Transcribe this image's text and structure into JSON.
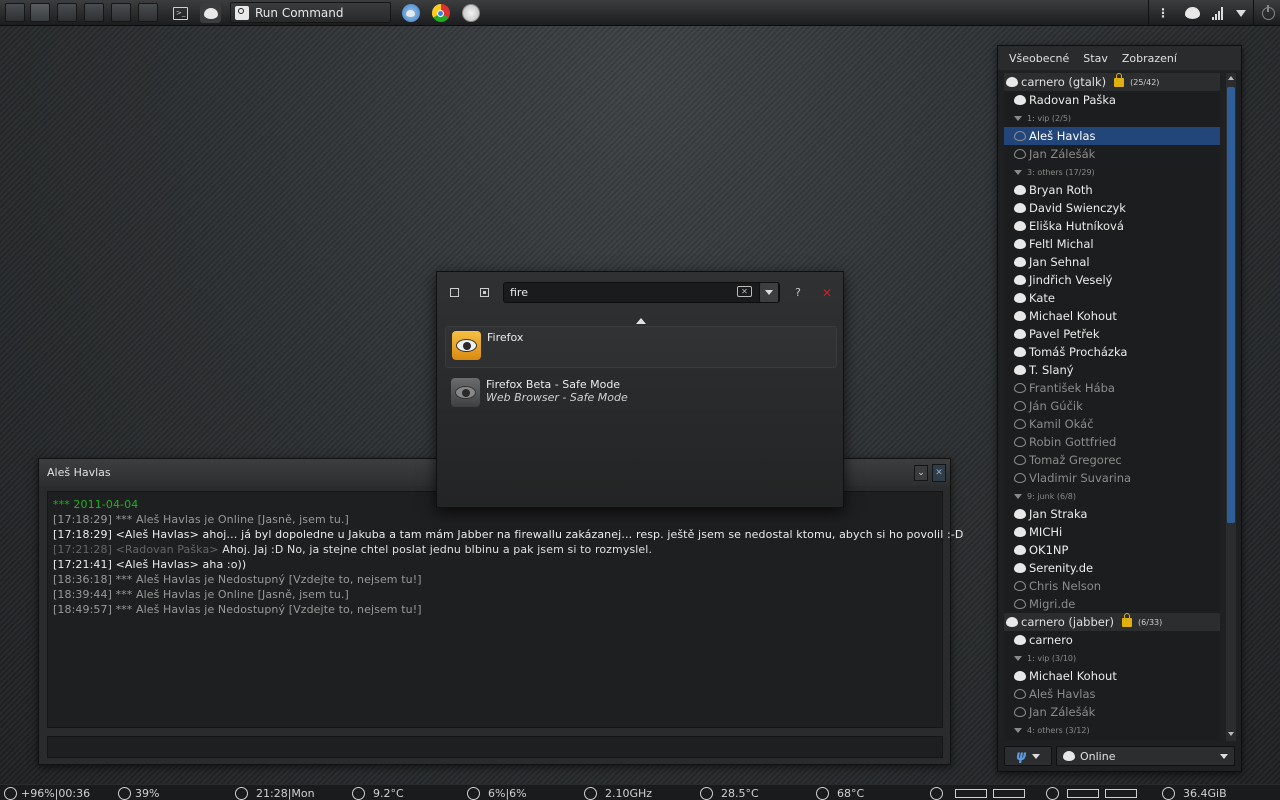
{
  "top_panel": {
    "run_command_label": "Run Command"
  },
  "bottom_panel": {
    "battery": "+96%|00:36",
    "volume": "39%",
    "clock": "21:28|Mon",
    "weather": "9.2°C",
    "cpu": "6%|6%",
    "cpu_freq": "2.10GHz",
    "temp1": "28.5°C",
    "temp2": "68°C",
    "disk": "36.4GiB"
  },
  "chat": {
    "title": "Aleš Havlas",
    "date_line": "*** 2011-04-04",
    "lines": [
      {
        "text": "[17:18:29] *** Aleš Havlas je Online [Jasně, jsem tu.]",
        "kind": "status"
      },
      {
        "text": "[17:18:29] <Aleš Havlas> ahoj… já byl dopoledne u Jakuba a tam mám Jabber na firewallu zakázanej… resp. ještě jsem se nedostal ktomu, abych si ho povolil :-D",
        "kind": "incoming"
      },
      {
        "text": "[17:21:28] <Radovan Paška> Ahoj. Jaj :D No, ja stejne chtel poslat jednu blbinu a pak jsem si to rozmyslel.",
        "kind": "own"
      },
      {
        "text": "[17:21:41] <Aleš Havlas> aha :o))",
        "kind": "incoming"
      },
      {
        "text": "[18:36:18] *** Aleš Havlas je Nedostupný [Vzdejte to, nejsem tu!]",
        "kind": "status"
      },
      {
        "text": "[18:39:44] *** Aleš Havlas je Online [Jasně, jsem tu.]",
        "kind": "status"
      },
      {
        "text": "[18:49:57] *** Aleš Havlas je Nedostupný [Vzdejte to, nejsem tu!]",
        "kind": "status"
      }
    ],
    "own_prefix": "[17:21:28] <Radovan Paška>",
    "own_text": " Ahoj. Jaj :D No, ja stejne chtel poslat jednu blbinu a pak jsem si to rozmyslel."
  },
  "krunner": {
    "query": "fire",
    "help_label": "?",
    "results": [
      {
        "title": "Firefox",
        "subtitle": ""
      },
      {
        "title": "Firefox Beta - Safe Mode",
        "subtitle": "Web Browser - Safe Mode"
      }
    ]
  },
  "buddy_list": {
    "menu": [
      "Všeobecné",
      "Stav",
      "Zobrazení"
    ],
    "status_value": "Online",
    "rows": [
      {
        "type": "account",
        "label": "carnero (gtalk)",
        "count": "(25/42)"
      },
      {
        "type": "contact",
        "label": "Radovan Paška",
        "status": "online"
      },
      {
        "type": "group",
        "label": "1: vip  (2/5)"
      },
      {
        "type": "contact",
        "label": "Aleš Havlas",
        "status": "offline",
        "selected": true
      },
      {
        "type": "contact",
        "label": "Jan Zálešák",
        "status": "offline"
      },
      {
        "type": "group",
        "label": "3: others  (17/29)"
      },
      {
        "type": "contact",
        "label": "Bryan Roth",
        "status": "online"
      },
      {
        "type": "contact",
        "label": "David Swienczyk",
        "status": "online"
      },
      {
        "type": "contact",
        "label": "Eliška Hutníková",
        "status": "online"
      },
      {
        "type": "contact",
        "label": "Feltl Michal",
        "status": "online"
      },
      {
        "type": "contact",
        "label": "Jan Sehnal",
        "status": "online"
      },
      {
        "type": "contact",
        "label": "Jindřich Veselý",
        "status": "online"
      },
      {
        "type": "contact",
        "label": "Kate",
        "status": "online"
      },
      {
        "type": "contact",
        "label": "Michael Kohout",
        "status": "online"
      },
      {
        "type": "contact",
        "label": "Pavel Petřek",
        "status": "online"
      },
      {
        "type": "contact",
        "label": "Tomáš Procházka",
        "status": "online"
      },
      {
        "type": "contact",
        "label": "T. Slaný",
        "status": "online"
      },
      {
        "type": "contact",
        "label": "František Hába",
        "status": "offline"
      },
      {
        "type": "contact",
        "label": "Ján Gúčik",
        "status": "offline"
      },
      {
        "type": "contact",
        "label": "Kamil Okáč",
        "status": "offline"
      },
      {
        "type": "contact",
        "label": "Robin Gottfried",
        "status": "offline"
      },
      {
        "type": "contact",
        "label": "Tomaž Gregorec",
        "status": "offline"
      },
      {
        "type": "contact",
        "label": "Vladimir Suvarina",
        "status": "offline"
      },
      {
        "type": "group",
        "label": "9: junk  (6/8)"
      },
      {
        "type": "contact",
        "label": "Jan Straka",
        "status": "online"
      },
      {
        "type": "contact",
        "label": "MICHi",
        "status": "online"
      },
      {
        "type": "contact",
        "label": "OK1NP",
        "status": "online"
      },
      {
        "type": "contact",
        "label": "Serenity.de",
        "status": "online"
      },
      {
        "type": "contact",
        "label": "Chris Nelson",
        "status": "offline"
      },
      {
        "type": "contact",
        "label": "Migri.de",
        "status": "offline"
      },
      {
        "type": "account",
        "label": "carnero (jabber)",
        "count": "(6/33)"
      },
      {
        "type": "contact",
        "label": "carnero",
        "status": "online"
      },
      {
        "type": "group",
        "label": "1: vip  (3/10)"
      },
      {
        "type": "contact",
        "label": "Michael Kohout",
        "status": "online"
      },
      {
        "type": "contact",
        "label": "Aleš Havlas",
        "status": "offline"
      },
      {
        "type": "contact",
        "label": "Jan Zálešák",
        "status": "offline"
      },
      {
        "type": "group",
        "label": "4: others  (3/12)"
      }
    ]
  },
  "colors": {
    "selection": "#23467a",
    "date_line": "#22b022",
    "close": "#cc2222",
    "firefox_icon": "#e8a020",
    "scroll_thumb": "#2f5f98"
  }
}
